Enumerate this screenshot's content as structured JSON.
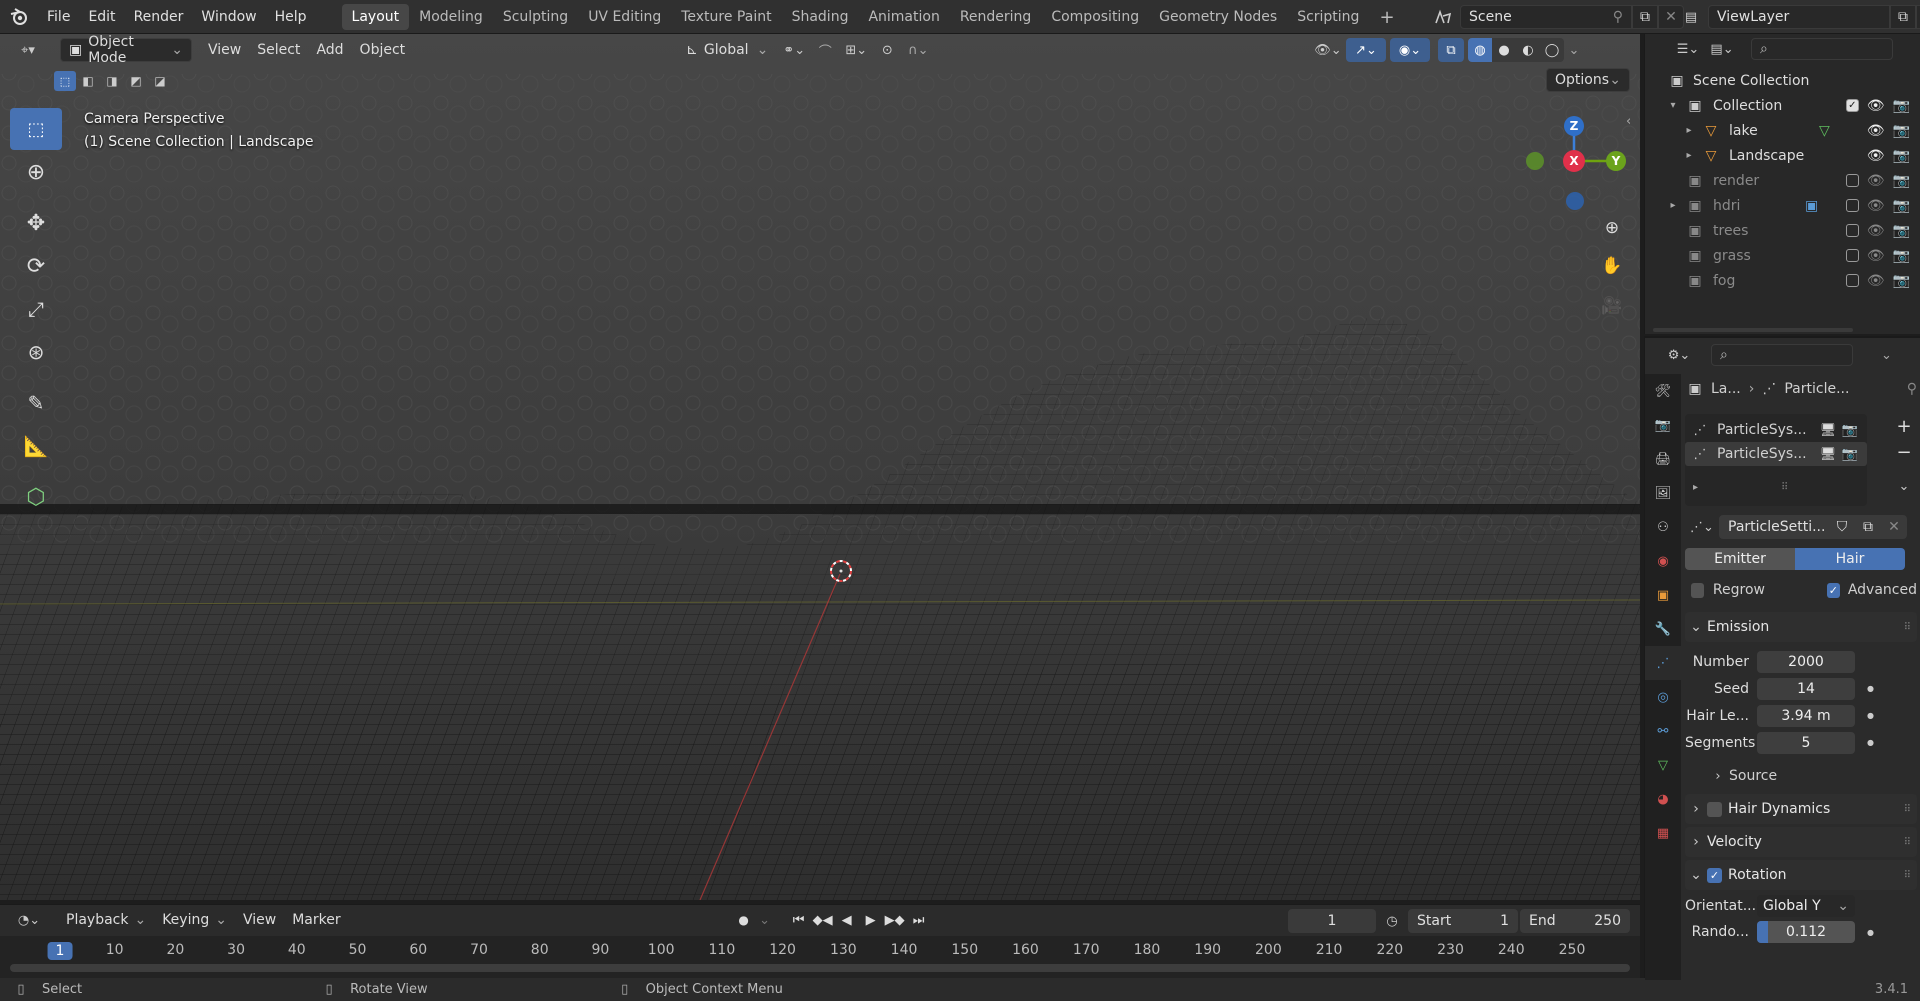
{
  "menus": [
    "File",
    "Edit",
    "Render",
    "Window",
    "Help"
  ],
  "workspaces": [
    {
      "label": "Layout",
      "active": true
    },
    {
      "label": "Modeling",
      "active": false
    },
    {
      "label": "Sculpting",
      "active": false
    },
    {
      "label": "UV Editing",
      "active": false
    },
    {
      "label": "Texture Paint",
      "active": false
    },
    {
      "label": "Shading",
      "active": false
    },
    {
      "label": "Animation",
      "active": false
    },
    {
      "label": "Rendering",
      "active": false
    },
    {
      "label": "Compositing",
      "active": false
    },
    {
      "label": "Geometry Nodes",
      "active": false
    },
    {
      "label": "Scripting",
      "active": false
    }
  ],
  "scene": {
    "name": "Scene"
  },
  "view_layer": {
    "name": "ViewLayer"
  },
  "viewport": {
    "mode": "Object Mode",
    "menus": [
      "View",
      "Select",
      "Add",
      "Object"
    ],
    "orientation": "Global",
    "options": "Options",
    "info_line1": "Camera Perspective",
    "info_line2": "(1) Scene Collection | Landscape",
    "gizmo": {
      "x": "X",
      "y": "Y",
      "z": "Z"
    }
  },
  "timeline": {
    "menus": [
      "Playback",
      "Keying",
      "View",
      "Marker"
    ],
    "current_frame": "1",
    "start_label": "Start",
    "start": "1",
    "end_label": "End",
    "end": "250",
    "ticks": [
      "1",
      "10",
      "20",
      "30",
      "40",
      "50",
      "60",
      "70",
      "80",
      "90",
      "100",
      "110",
      "120",
      "130",
      "140",
      "150",
      "160",
      "170",
      "180",
      "190",
      "200",
      "210",
      "220",
      "230",
      "240",
      "250"
    ]
  },
  "status": {
    "left": "Select",
    "middle": "Rotate View",
    "right": "Object Context Menu",
    "version": "3.4.1"
  },
  "outliner": {
    "root": "Scene Collection",
    "items": [
      {
        "label": "Collection",
        "level": 0,
        "checked": true
      },
      {
        "label": "lake",
        "level": 1
      },
      {
        "label": "Landscape",
        "level": 1
      },
      {
        "label": "render",
        "level": 0,
        "checked": false
      },
      {
        "label": "hdri",
        "level": 0,
        "checked": false
      },
      {
        "label": "trees",
        "level": 0,
        "checked": false
      },
      {
        "label": "grass",
        "level": 0,
        "checked": false
      },
      {
        "label": "fog",
        "level": 0,
        "checked": false
      }
    ]
  },
  "properties": {
    "breadcrumb_obj": "La...",
    "breadcrumb_data": "Particle...",
    "systems": [
      "ParticleSys...",
      "ParticleSys..."
    ],
    "settings_name": "ParticleSetti...",
    "type_tabs": [
      {
        "label": "Emitter",
        "active": false
      },
      {
        "label": "Hair",
        "active": true
      }
    ],
    "regrow": "Regrow",
    "advanced": "Advanced",
    "emission": {
      "title": "Emission",
      "number_label": "Number",
      "number": "2000",
      "seed_label": "Seed",
      "seed": "14",
      "hair_label": "Hair Le...",
      "hair": "3.94 m",
      "segments_label": "Segments",
      "segments": "5",
      "source": "Source"
    },
    "hair_dynamics": "Hair Dynamics",
    "velocity": "Velocity",
    "rotation": {
      "title": "Rotation",
      "orient_label": "Orientat...",
      "orient": "Global Y",
      "rand_label": "Rando...",
      "rand": "0.112",
      "rand_fraction": 0.112
    }
  }
}
